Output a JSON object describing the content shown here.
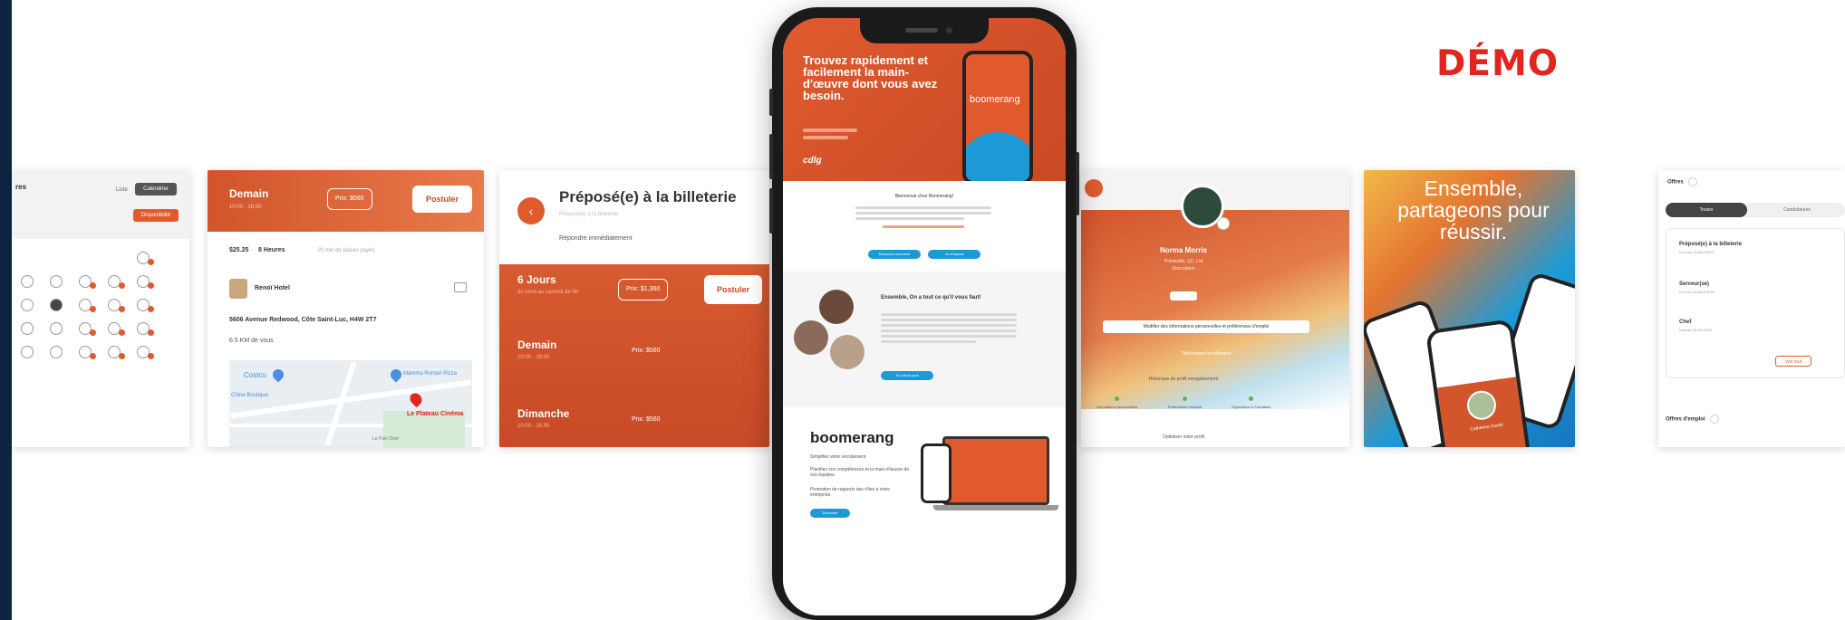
{
  "demo_label": "DÉMO",
  "calendar": {
    "month_label": "res",
    "toggle_a": "Liste",
    "toggle_b": "Calendrier",
    "badge": "Disponibilité"
  },
  "offer": {
    "title": "Demain",
    "time": "10:00 - 18:00",
    "amount_pill": "Prix: $560",
    "apply": "Postuler",
    "pay": "$25.25",
    "hours": "8 Heures",
    "distance_note": "20 min de places payés",
    "employer": "Renoï Hotel",
    "address": "5606 Avenue Redwood, Côte Saint-Luc, H4W 2T7",
    "km": "6.5 KM de vous",
    "map_labels": [
      "Costco",
      "Mamma Roman Pizza",
      "Chine Boutique",
      "Le Pain Doré",
      "Le Plateau Cinéma"
    ]
  },
  "ticket": {
    "title": "Préposé(e) à la billeterie",
    "subtitle": "Préposé(e) à la billeterie",
    "immediate": "Répondre immédiatement",
    "rows": [
      {
        "label": "6 Jours",
        "sub": "du lundi au samedi de 9h",
        "price": "Prix: $1,360",
        "apply": "Postuler"
      },
      {
        "label": "Demain",
        "sub": "10:00 - 18:00",
        "price": "Prix: $560"
      },
      {
        "label": "Dimanche",
        "sub": "10:00 - 18:00",
        "price": "Prix: $560"
      }
    ]
  },
  "phone": {
    "hero_title": "Trouvez rapidement et facilement la main-d'œuvre dont vous avez besoin.",
    "hero_brand": "boomerang",
    "hero_logo": "cdlg",
    "welcome": "Bienvenue chez Boomerang!",
    "btn_a": "Découvrir comment",
    "btn_b": "Je m'inscris",
    "quote_title": "Ensemble, On a tout ce qu'il vous faut!",
    "more_btn": "En savoir plus",
    "brand": "boomerang",
    "brand_lines": [
      "Simplifier votre recrutement.",
      "Planifiez vos compétences et la main-d'œuvre de vos équipes.",
      "Promotion de rapports des rôles à votre entreprise."
    ],
    "brand_btn": "Découvrir"
  },
  "profile": {
    "name": "Norma Morris",
    "role": "Pointsville, QC, Ltd",
    "sub": "Description",
    "btn_a": "Modifier des informations personnelles et préférences d'emploi",
    "btn_b": "Téléchargez la référence",
    "section": "Historique de profil enregistrement",
    "stats": [
      "Informations personnelles",
      "Préférences d'emploi",
      "Expérience & Formation"
    ],
    "footer": "Optimiser votre profil"
  },
  "promo": {
    "title": "Ensemble, partageons pour réussir.",
    "person": "Catherine Durtel"
  },
  "offers": {
    "header": "Offres",
    "tab_a": "Toutes",
    "tab_b": "Candidatures",
    "items": [
      {
        "title": "Préposé(e) à la billeterie",
        "sub": "Du 6 au 14 Août 2024"
      },
      {
        "title": "Serveur(se)",
        "sub": "Du 6 au 14 Août 2024"
      },
      {
        "title": "Chef",
        "sub": "Demain 10:00-18:00"
      }
    ],
    "more": "Voir tout",
    "footer": "Offres d'emploi"
  },
  "colors": {
    "orange": "#c84a26",
    "orange_light": "#e06a3e",
    "blue": "#1d9ad6",
    "red": "#e3241f",
    "navy": "#0e2443"
  }
}
